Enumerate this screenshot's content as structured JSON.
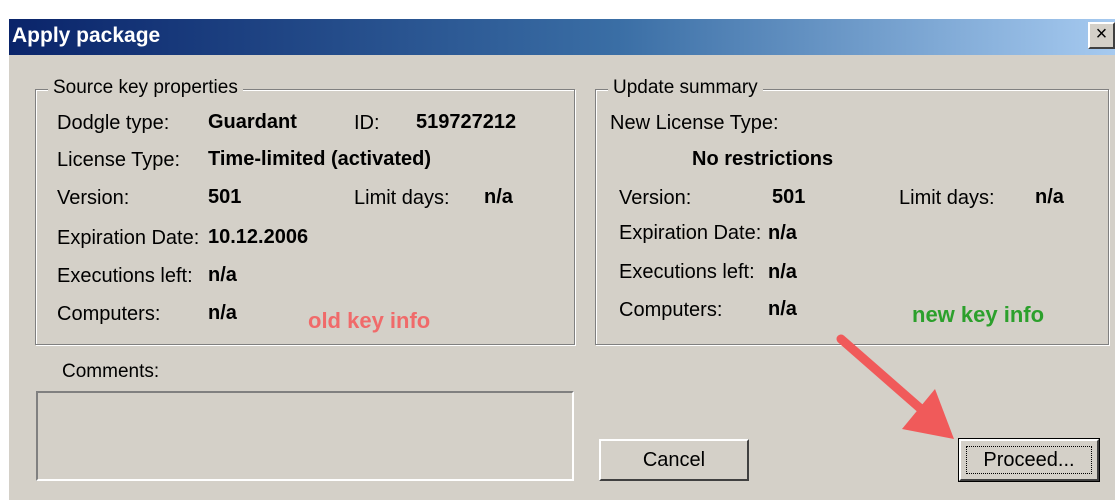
{
  "window": {
    "title": "Apply package",
    "close_glyph": "×"
  },
  "source": {
    "legend": "Source key properties",
    "dongle_type_label": "Dodgle type:",
    "dongle_type_value": "Guardant",
    "id_label": "ID:",
    "id_value": "519727212",
    "license_type_label": "License Type:",
    "license_type_value": "Time-limited (activated)",
    "version_label": "Version:",
    "version_value": "501",
    "limit_days_label": "Limit days:",
    "limit_days_value": "n/a",
    "expiration_label": "Expiration Date:",
    "expiration_value": "10.12.2006",
    "executions_label": "Executions left:",
    "executions_value": "n/a",
    "computers_label": "Computers:",
    "computers_value": "n/a",
    "annotation": "old key info"
  },
  "summary": {
    "legend": "Update summary",
    "new_license_label": "New License Type:",
    "new_license_value": "No restrictions",
    "version_label": "Version:",
    "version_value": "501",
    "limit_days_label": "Limit days:",
    "limit_days_value": "n/a",
    "expiration_label": "Expiration Date:",
    "expiration_value": "n/a",
    "executions_label": "Executions left:",
    "executions_value": "n/a",
    "computers_label": "Computers:",
    "computers_value": "n/a",
    "annotation": "new key info"
  },
  "comments": {
    "label": "Comments:",
    "value": ""
  },
  "buttons": {
    "cancel": "Cancel",
    "proceed": "Proceed..."
  },
  "colors": {
    "old_note": "#f06a6a",
    "new_note": "#2ca02c",
    "arrow": "#f05a5a"
  },
  "icons": {
    "close": "close-icon",
    "arrow": "annotation-arrow"
  }
}
